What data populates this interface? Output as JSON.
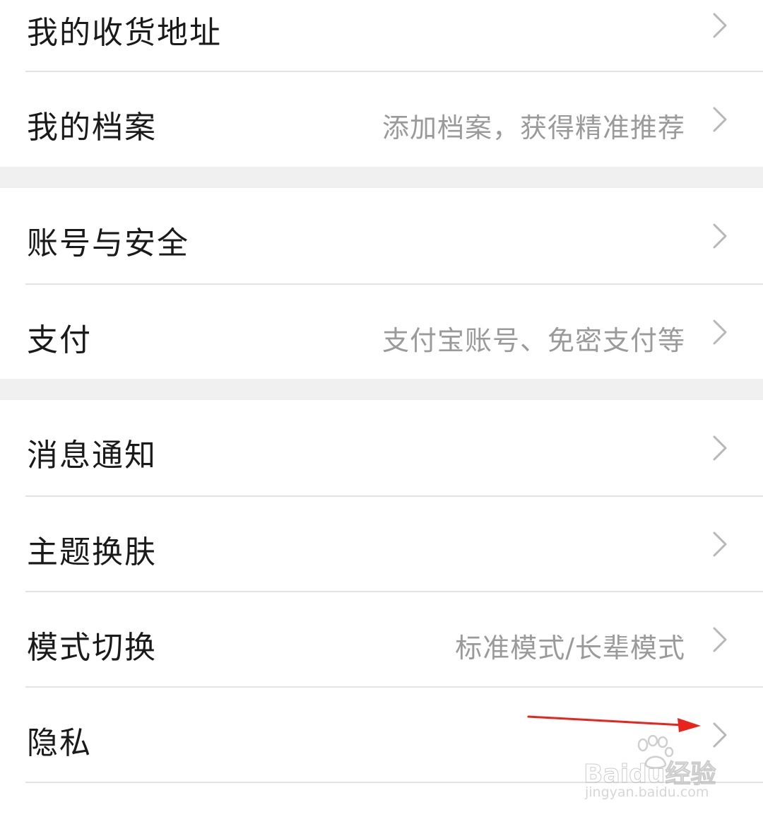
{
  "settings": {
    "items": [
      {
        "label": "我的收货地址",
        "hint": ""
      },
      {
        "label": "我的档案",
        "hint": "添加档案，获得精准推荐"
      },
      {
        "label": "账号与安全",
        "hint": ""
      },
      {
        "label": "支付",
        "hint": "支付宝账号、免密支付等"
      },
      {
        "label": "消息通知",
        "hint": ""
      },
      {
        "label": "主题换肤",
        "hint": ""
      },
      {
        "label": "模式切换",
        "hint": "标准模式/长辈模式"
      },
      {
        "label": "隐私",
        "hint": ""
      }
    ]
  },
  "annotation": {
    "arrow_color": "#e8241c"
  },
  "watermark": {
    "brand": "Baidu经验",
    "url": "jingyan.baidu.com"
  }
}
